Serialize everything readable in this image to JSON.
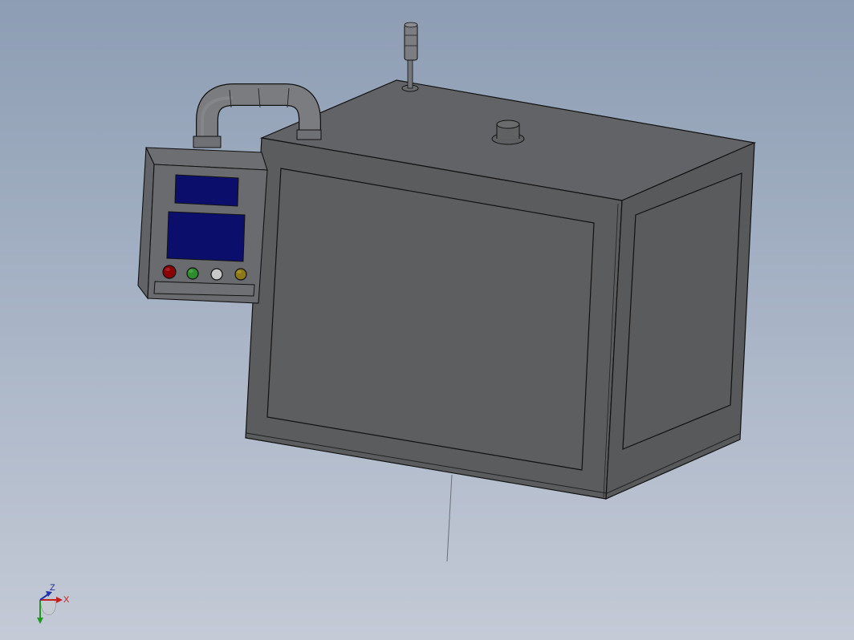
{
  "viewport": {
    "background_top": "#8d9db3",
    "background_bottom": "#c4cad6"
  },
  "model": {
    "body_color": "#5c5d5f",
    "edge_color": "#111111",
    "screen_color": "#0b0f6b"
  },
  "control_panel": {
    "button_colors": [
      "#8b0000",
      "#2e8b2e",
      "#c8c8c8",
      "#8c7a1a"
    ],
    "buttons": [
      "red-button",
      "green-button",
      "white-button",
      "yellow-button"
    ]
  },
  "triad": {
    "z_label": "Z",
    "x_label": "X"
  }
}
